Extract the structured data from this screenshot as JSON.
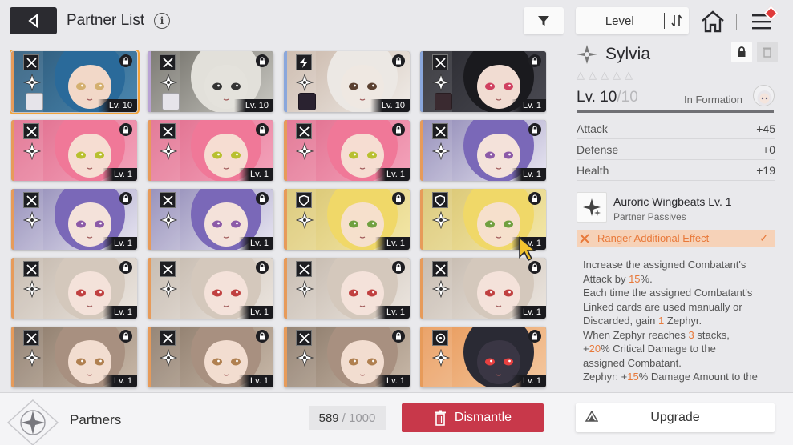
{
  "header": {
    "title": "Partner List",
    "info_icon": "i",
    "sort_label": "Level"
  },
  "cards": [
    {
      "level": "Lv. 10",
      "strip": "#e79b5a",
      "bg": [
        "#2e5a7a",
        "#4a87b0"
      ],
      "hair": "#2a6a9a",
      "eyes": "#d4b070",
      "skin": "#f2d8c8",
      "type": "crossed-swords",
      "selected": true
    },
    {
      "level": "Lv. 10",
      "strip": "#b9a3d4",
      "bg": [
        "#6f6d66",
        "#c9c8c2"
      ],
      "hair": "#e2e0da",
      "eyes": "#333",
      "skin": "#e4e2dc",
      "type": "crossed-swords"
    },
    {
      "level": "Lv. 10",
      "strip": "#8aa7dc",
      "bg": [
        "#c9b6a8",
        "#f0ece8"
      ],
      "hair": "#ece8e4",
      "eyes": "#5a4030",
      "skin": "#efe8e2",
      "type": "lightning"
    },
    {
      "level": "Lv. 1",
      "strip": "#8aa7dc",
      "bg": [
        "#2a2a30",
        "#4a4a52"
      ],
      "hair": "#1a1a1e",
      "eyes": "#d04060",
      "skin": "#f1dcd2",
      "type": "crossed-swords"
    },
    {
      "level": "Lv. 1",
      "strip": "#e79b5a",
      "bg": [
        "#e06c8c",
        "#f4a4bc"
      ],
      "hair": "#f07898",
      "eyes": "#b8c030",
      "skin": "#f6ddd2",
      "type": "crossed-swords"
    },
    {
      "level": "Lv. 1",
      "strip": "#e79b5a",
      "bg": [
        "#e06c8c",
        "#f4a4bc"
      ],
      "hair": "#f07898",
      "eyes": "#b8c030",
      "skin": "#f6ddd2",
      "type": "crossed-swords"
    },
    {
      "level": "Lv. 1",
      "strip": "#e79b5a",
      "bg": [
        "#e06c8c",
        "#f4a4bc"
      ],
      "hair": "#f07898",
      "eyes": "#b8c030",
      "skin": "#f6ddd2",
      "type": "crossed-swords"
    },
    {
      "level": "Lv. 1",
      "strip": "#e79b5a",
      "bg": [
        "#8d86b4",
        "#e8e6f2"
      ],
      "hair": "#7a68b8",
      "eyes": "#8c5aa8",
      "skin": "#f4e2da",
      "type": "crossed-swords"
    },
    {
      "level": "Lv. 1",
      "strip": "#e79b5a",
      "bg": [
        "#8d86b4",
        "#e8e6f2"
      ],
      "hair": "#7a68b8",
      "eyes": "#8c5aa8",
      "skin": "#f4e2da",
      "type": "crossed-swords"
    },
    {
      "level": "Lv. 1",
      "strip": "#e79b5a",
      "bg": [
        "#8d86b4",
        "#e8e6f2"
      ],
      "hair": "#7a68b8",
      "eyes": "#8c5aa8",
      "skin": "#f4e2da",
      "type": "crossed-swords"
    },
    {
      "level": "Lv. 1",
      "strip": "#e79b5a",
      "bg": [
        "#d8c470",
        "#f4e8a8"
      ],
      "hair": "#f0d868",
      "eyes": "#70a040",
      "skin": "#f6e0cc",
      "type": "shield"
    },
    {
      "level": "Lv. 1",
      "strip": "#e79b5a",
      "bg": [
        "#d8c470",
        "#f4e8a8"
      ],
      "hair": "#f0d868",
      "eyes": "#70a040",
      "skin": "#f6e0cc",
      "type": "shield"
    },
    {
      "level": "Lv. 1",
      "strip": "#e79b5a",
      "bg": [
        "#c2b6aa",
        "#ece6e0"
      ],
      "hair": "#d4c8bc",
      "eyes": "#c04040",
      "skin": "#f4e2da",
      "type": "crossed-swords"
    },
    {
      "level": "Lv. 1",
      "strip": "#e79b5a",
      "bg": [
        "#c2b6aa",
        "#ece6e0"
      ],
      "hair": "#d4c8bc",
      "eyes": "#c04040",
      "skin": "#f4e2da",
      "type": "crossed-swords"
    },
    {
      "level": "Lv. 1",
      "strip": "#e79b5a",
      "bg": [
        "#c2b6aa",
        "#ece6e0"
      ],
      "hair": "#d4c8bc",
      "eyes": "#c04040",
      "skin": "#f4e2da",
      "type": "crossed-swords"
    },
    {
      "level": "Lv. 1",
      "strip": "#e79b5a",
      "bg": [
        "#c2b6aa",
        "#ece6e0"
      ],
      "hair": "#d4c8bc",
      "eyes": "#c04040",
      "skin": "#f4e2da",
      "type": "crossed-swords"
    },
    {
      "level": "Lv. 1",
      "strip": "#e79b5a",
      "bg": [
        "#8a7868",
        "#c8b8a8"
      ],
      "hair": "#a89080",
      "eyes": "#b08050",
      "skin": "#f2ddd0",
      "type": "crossed-swords"
    },
    {
      "level": "Lv. 1",
      "strip": "#e79b5a",
      "bg": [
        "#8a7868",
        "#c8b8a8"
      ],
      "hair": "#a89080",
      "eyes": "#b08050",
      "skin": "#f2ddd0",
      "type": "crossed-swords"
    },
    {
      "level": "Lv. 1",
      "strip": "#e79b5a",
      "bg": [
        "#8a7868",
        "#c8b8a8"
      ],
      "hair": "#a89080",
      "eyes": "#b08050",
      "skin": "#f2ddd0",
      "type": "crossed-swords"
    },
    {
      "level": "Lv. 1",
      "strip": "#e79b5a",
      "bg": [
        "#e89858",
        "#f4c8a0"
      ],
      "hair": "#2a2a34",
      "eyes": "#e84040",
      "skin": "#3a3644",
      "type": "target"
    }
  ],
  "detail": {
    "name": "Sylvia",
    "stars": 5,
    "level": "Lv. 10",
    "level_max": "/10",
    "level_progress": 1.0,
    "formation_label": "In Formation",
    "stats": [
      {
        "label": "Attack",
        "value": "+45"
      },
      {
        "label": "Defense",
        "value": "+0"
      },
      {
        "label": "Health",
        "value": "+19"
      }
    ],
    "passive_name": "Auroric Wingbeats Lv. 1",
    "passive_sub": "Partner Passives",
    "ranger_label": "Ranger Additional Effect",
    "desc_lines": [
      [
        {
          "t": "Increase the assigned Combatant's"
        }
      ],
      [
        {
          "t": "Attack by "
        },
        {
          "t": "15",
          "hl": true
        },
        {
          "t": "%."
        }
      ],
      [
        {
          "t": "Each time the assigned Combatant's"
        }
      ],
      [
        {
          "t": "Linked cards are used manually or"
        }
      ],
      [
        {
          "t": "Discarded, gain "
        },
        {
          "t": "1",
          "hl": true
        },
        {
          "t": " Zephyr."
        }
      ],
      [
        {
          "t": "When Zephyr reaches "
        },
        {
          "t": "3",
          "hl": true
        },
        {
          "t": " stacks,"
        }
      ],
      [
        {
          "t": "+"
        },
        {
          "t": "20",
          "hl": true
        },
        {
          "t": "% Critical Damage to the"
        }
      ],
      [
        {
          "t": "assigned Combatant."
        }
      ],
      [
        {
          "t": "Zephyr: +"
        },
        {
          "t": "15",
          "hl": true
        },
        {
          "t": "% Damage Amount to the"
        }
      ]
    ]
  },
  "bottom": {
    "partners_label": "Partners",
    "count": "589",
    "count_max": "/ 1000",
    "dismantle_label": "Dismantle",
    "upgrade_label": "Upgrade"
  },
  "colors": {
    "accent_orange": "#e8793a",
    "dismantle_red": "#c8384a",
    "selected_outline": "#f2a33a"
  }
}
